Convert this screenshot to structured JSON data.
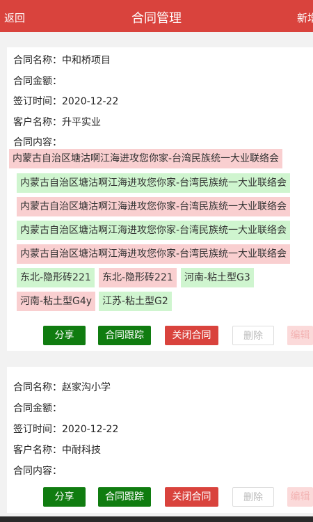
{
  "header": {
    "back_label": "返回",
    "title": "合同管理",
    "new_label": "新增"
  },
  "contract_1": {
    "name_label": "合同名称：",
    "name": "中和桥项目",
    "amount_label": "合同金额：",
    "amount": "",
    "date_label": "签订时间：",
    "date": "2020-12-22",
    "client_label": "客户名称：",
    "client": "升平实业",
    "content_label": "合同内容：",
    "tags": [
      "内蒙古自治区塘沽啊江海进攻您你家-台湾民族统一大业联络会",
      "内蒙古自治区塘沽啊江海进攻您你家-台湾民族统一大业联络会",
      "内蒙古自治区塘沽啊江海进攻您你家-台湾民族统一大业联络会",
      "内蒙古自治区塘沽啊江海进攻您你家-台湾民族统一大业联络会",
      "内蒙古自治区塘沽啊江海进攻您你家-台湾民族统一大业联络会",
      "东北-隐形砖221",
      "东北-隐形砖221",
      "河南-粘土型G3",
      "河南-粘土型G4y",
      "江苏-粘土型G2"
    ],
    "buttons": {
      "share": "分享",
      "track": "合同跟踪",
      "close": "关闭合同",
      "delete": "删除",
      "extra": "编辑"
    }
  },
  "contract_2": {
    "name_label": "合同名称：",
    "name": "赵家沟小学",
    "amount_label": "合同金额：",
    "amount": "",
    "date_label": "签订时间：",
    "date": "2020-12-22",
    "client_label": "客户名称：",
    "client": "中耐科技",
    "content_label": "合同内容：",
    "buttons": {
      "share": "分享",
      "track": "合同跟踪",
      "close": "关闭合同",
      "delete": "删除",
      "extra": "编辑"
    }
  },
  "colors": {
    "header": "#d9433d",
    "share_button": "#107c10",
    "close_button": "#d9433d",
    "tag_pink": "#f9cfd0",
    "tag_green": "#cff5cf"
  }
}
